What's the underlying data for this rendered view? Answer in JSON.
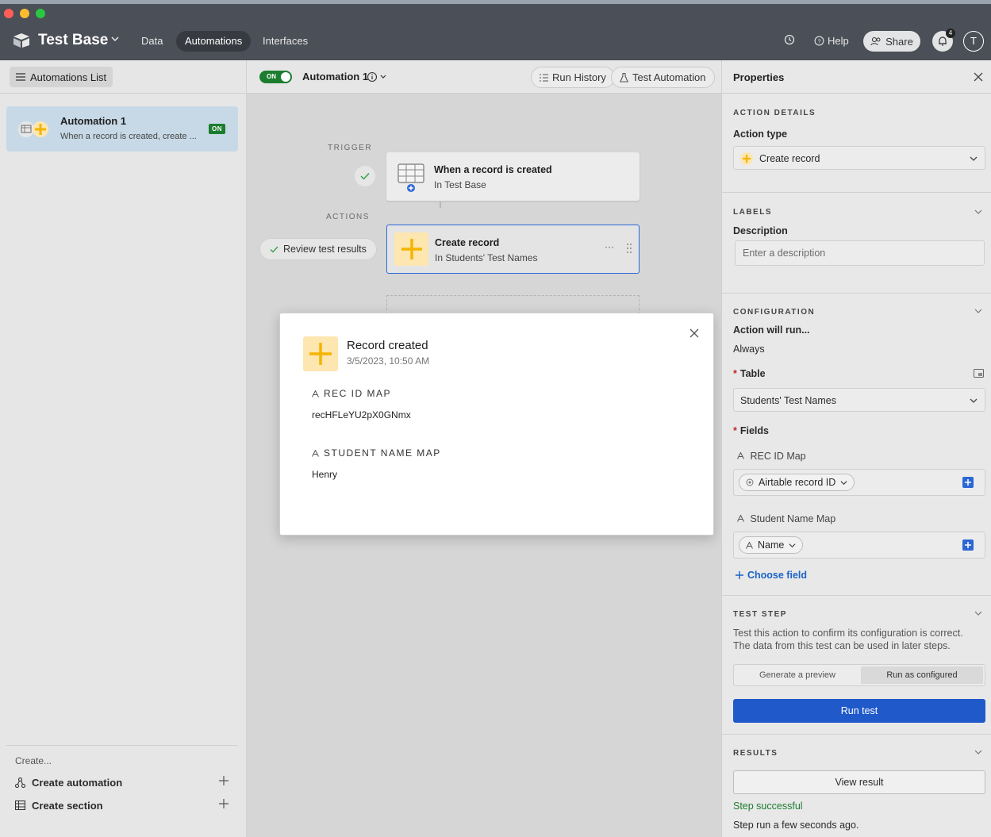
{
  "header": {
    "base_title": "Test Base",
    "nav": [
      {
        "label": "Data"
      },
      {
        "label": "Automations"
      },
      {
        "label": "Interfaces"
      }
    ],
    "help_label": "Help",
    "share_label": "Share",
    "notification_count": "4",
    "avatar_initial": "T",
    "icons": {
      "history": "history-icon",
      "help": "help-circle-icon",
      "share": "people-icon",
      "bell": "bell-icon"
    }
  },
  "sidebar": {
    "list_button": "Automations List",
    "automation": {
      "name": "Automation 1",
      "description": "When a record is created, create ...",
      "badge": "ON"
    },
    "create_label": "Create...",
    "create_items": [
      {
        "label": "Create automation",
        "icon": "automation-icon"
      },
      {
        "label": "Create section",
        "icon": "section-icon"
      }
    ]
  },
  "canvas": {
    "toggle_label": "ON",
    "automation_title": "Automation 1",
    "run_history_label": "Run History",
    "test_automation_label": "Test Automation",
    "trigger_label": "TRIGGER",
    "actions_label": "ACTIONS",
    "trigger_card": {
      "title": "When a record is created",
      "subtitle": "In Test Base"
    },
    "action_card": {
      "title": "Create record",
      "subtitle": "In Students' Test Names",
      "more": "···"
    },
    "review_button": "Review test results"
  },
  "modal": {
    "title": "Record created",
    "date": "3/5/2023, 10:50 AM",
    "fields": [
      {
        "label": "REC ID MAP",
        "value": "recHFLeYU2pX0GNmx"
      },
      {
        "label": "STUDENT NAME MAP",
        "value": "Henry"
      }
    ]
  },
  "properties": {
    "title": "Properties",
    "action_details": {
      "section": "ACTION DETAILS",
      "action_type_label": "Action type",
      "action_type_value": "Create record"
    },
    "labels": {
      "section": "LABELS",
      "description_label": "Description",
      "description_placeholder": "Enter a description"
    },
    "configuration": {
      "section": "CONFIGURATION",
      "run_label": "Action will run...",
      "run_value": "Always",
      "table_label": "Table",
      "table_value": "Students' Test Names",
      "fields_label": "Fields",
      "field1_label": "REC ID Map",
      "field1_token": "Airtable record ID",
      "field2_label": "Student Name Map",
      "field2_token": "Name",
      "choose_field": "Choose field"
    },
    "test_step": {
      "section": "TEST STEP",
      "description_line1": "Test this action to confirm its configuration is correct.",
      "description_line2": "The data from this test can be used in later steps.",
      "option_preview": "Generate a preview",
      "option_configured": "Run as configured",
      "run_button": "Run test"
    },
    "results": {
      "section": "RESULTS",
      "view_button": "View result",
      "status": "Step successful",
      "timestamp": "Step run a few seconds ago."
    }
  },
  "colors": {
    "brand_blue": "#2059c9",
    "on_green": "#1c7d2f",
    "header_bg": "#4b4f57",
    "plus_yellow": "#f5b400"
  }
}
